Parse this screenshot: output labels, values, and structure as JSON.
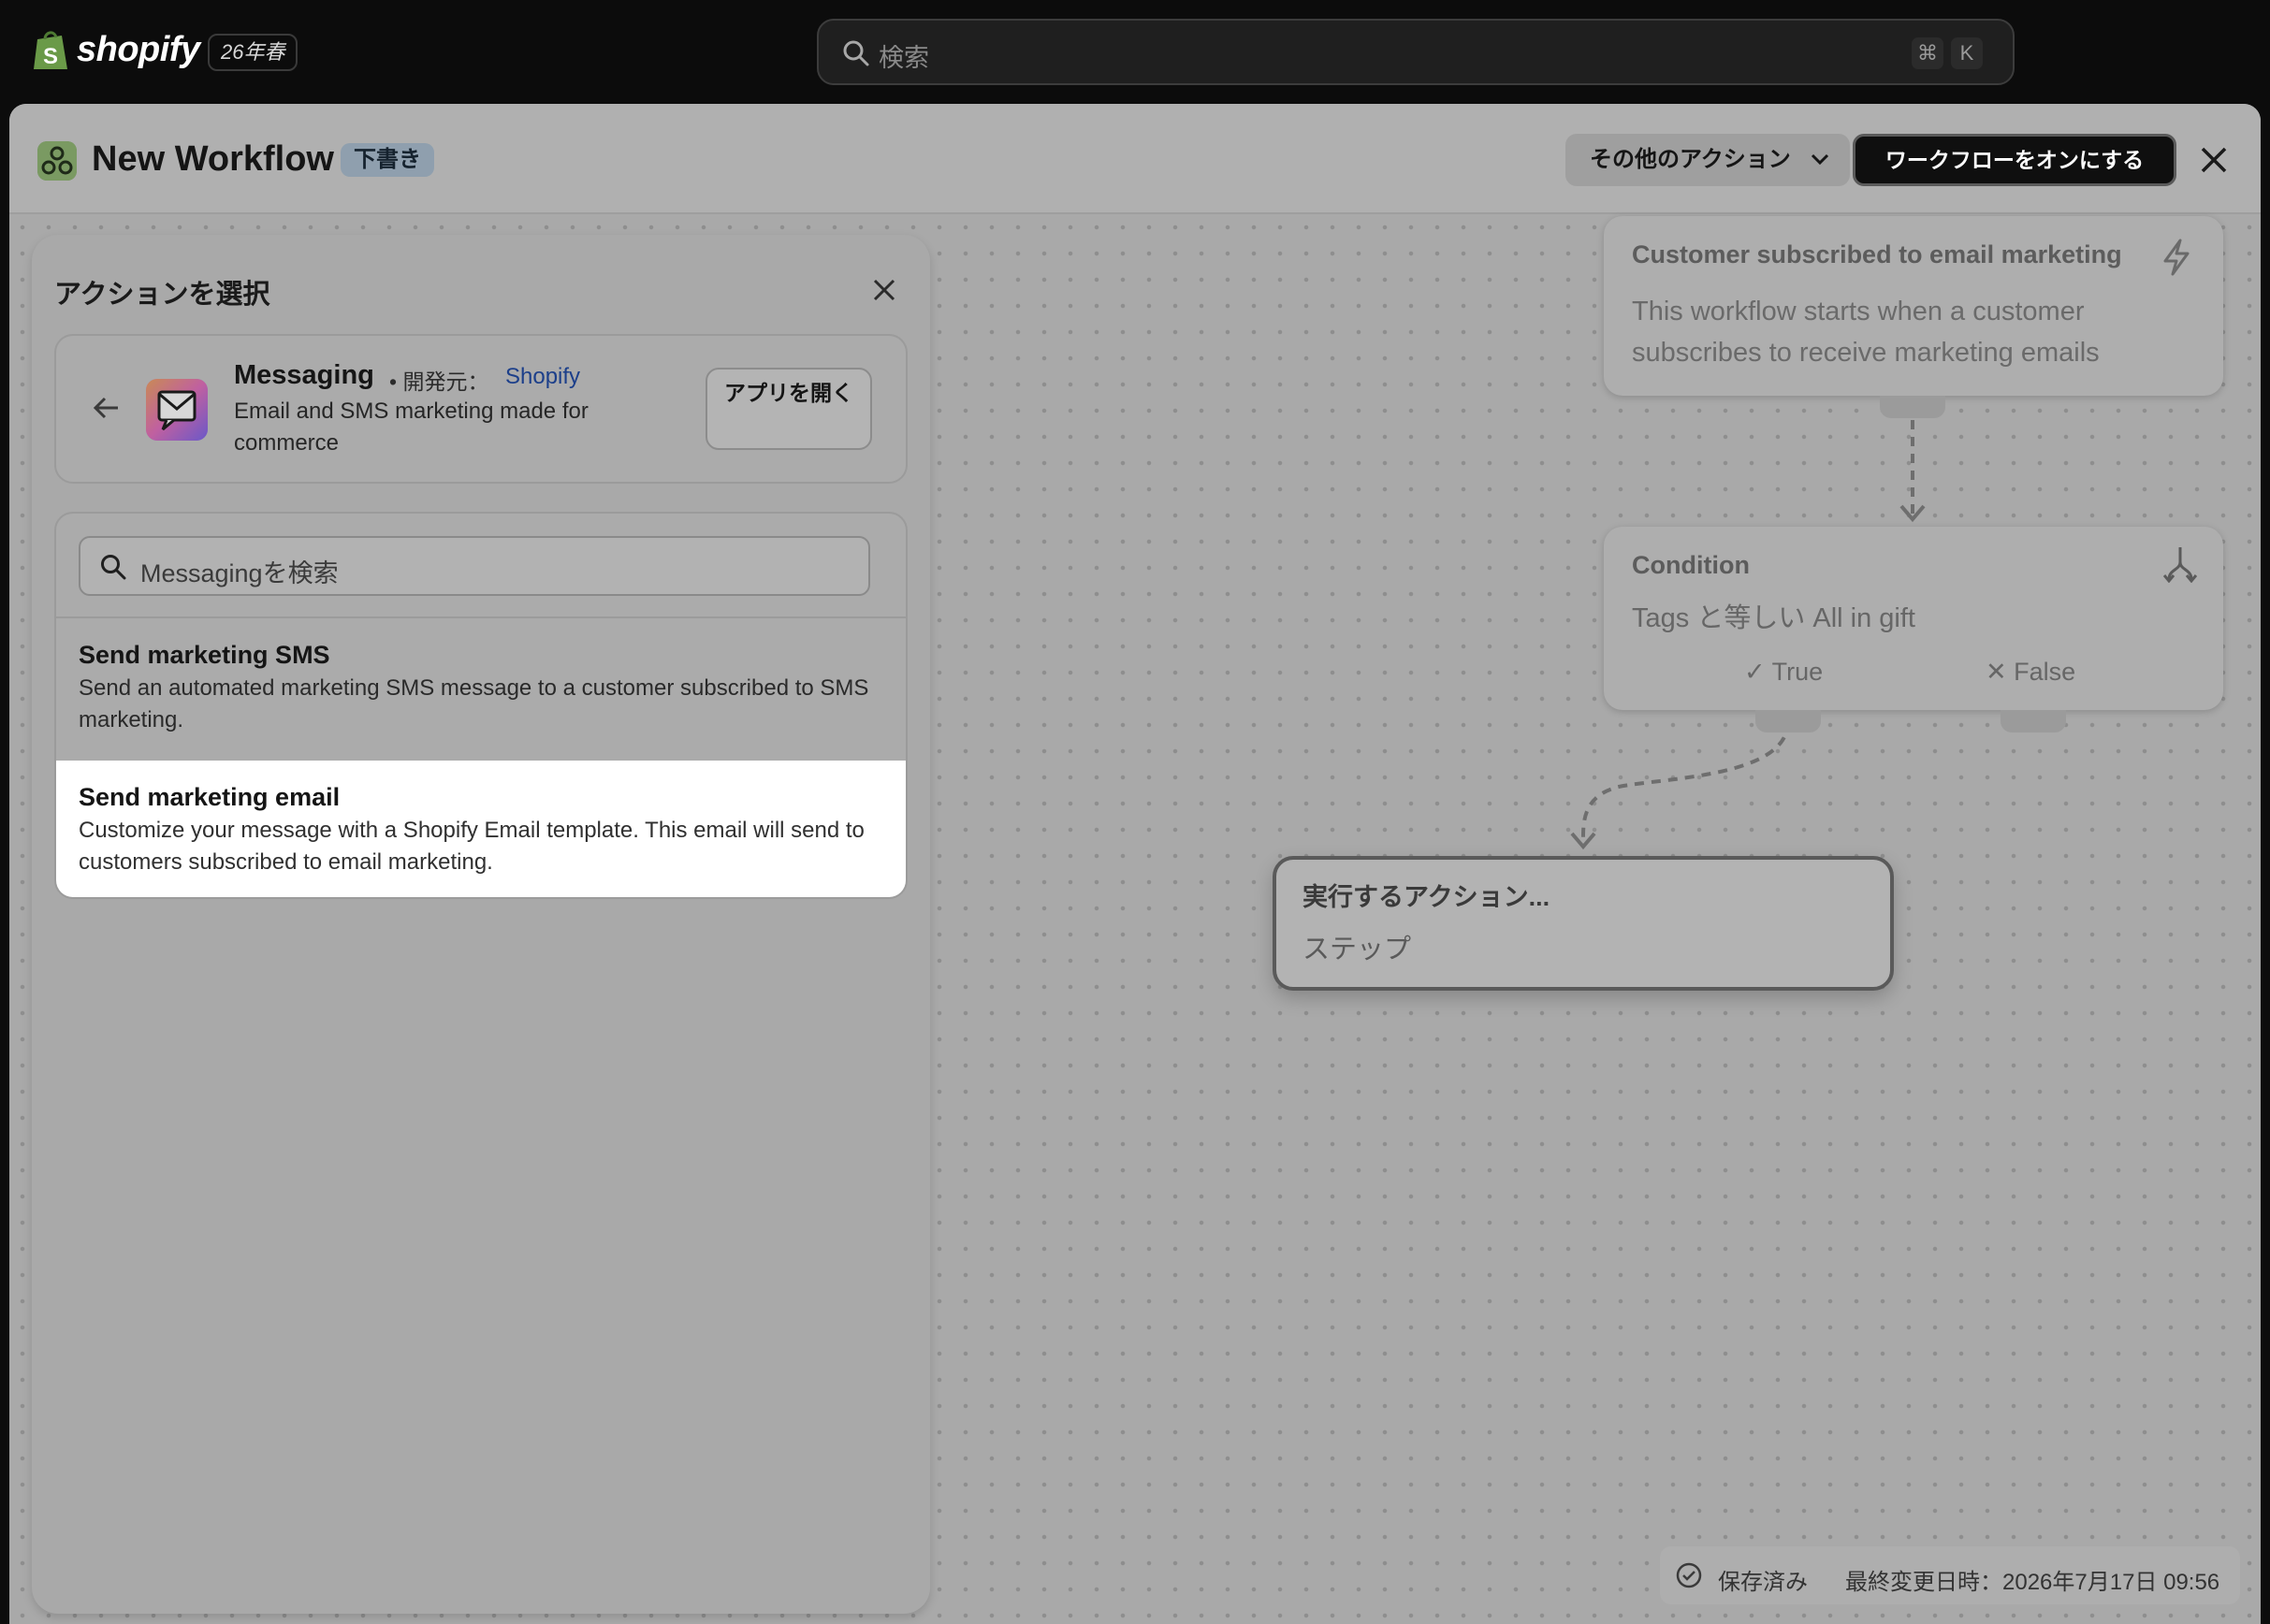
{
  "topbar": {
    "brand": "shopify",
    "edition": "26年春",
    "search_placeholder": "検索",
    "shortcut_key1": "⌘",
    "shortcut_key2": "K"
  },
  "header": {
    "title": "New Workflow",
    "status_badge": "下書き",
    "more_actions_label": "その他のアクション",
    "turn_on_label": "ワークフローをオンにする"
  },
  "panel": {
    "title": "アクションを選択",
    "app": {
      "name": "Messaging",
      "dev_prefix": "• 開発元：",
      "dev_link": "Shopify",
      "description": "Email and SMS marketing made for commerce",
      "open_label": "アプリを開く"
    },
    "search_placeholder": "Messagingを検索",
    "actions": [
      {
        "title": "Send marketing SMS",
        "description": "Send an automated marketing SMS message to a customer subscribed to SMS marketing."
      },
      {
        "title": "Send marketing email",
        "description": "Customize your message with a Shopify Email template. This email will send to customers subscribed to email marketing."
      }
    ]
  },
  "flow": {
    "trigger": {
      "title": "Customer subscribed to email marketing",
      "description": "This workflow starts when a customer subscribes to receive marketing emails"
    },
    "condition": {
      "title": "Condition",
      "description": "Tags と等しい All in gift",
      "true_label": "True",
      "false_label": "False"
    },
    "action": {
      "title": "実行するアクション...",
      "subtitle": "ステップ"
    }
  },
  "status": {
    "saved_label": "保存済み",
    "last_modified": "最終変更日時：2026年7月17日 09:56"
  },
  "colors": {
    "accent_link": "#1c3f8a",
    "primary_button": "#0f0f0f",
    "overlay_gray": "#a9a9a9"
  }
}
